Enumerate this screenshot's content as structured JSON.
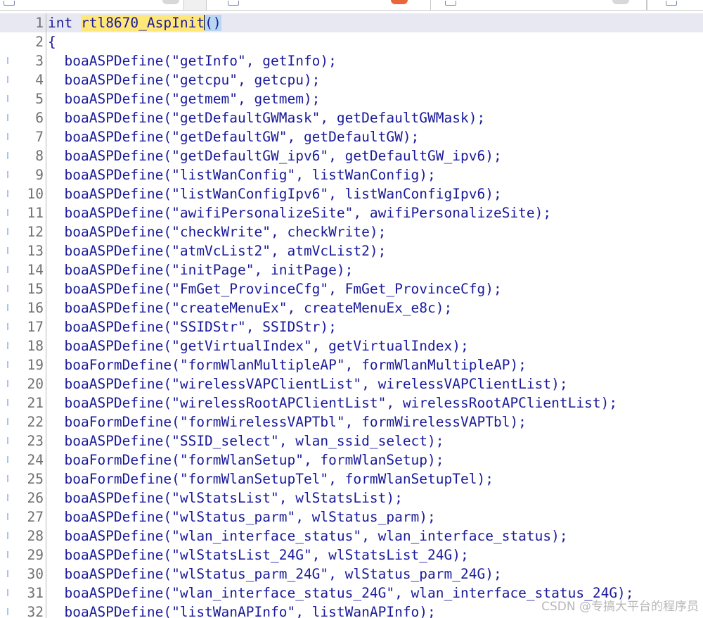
{
  "editor": {
    "lines": [
      {
        "n": "1",
        "text": "int rtl8670_AspInit()"
      },
      {
        "n": "2",
        "text": "{"
      },
      {
        "n": "3",
        "text": "  boaASPDefine(\"getInfo\", getInfo);"
      },
      {
        "n": "4",
        "text": "  boaASPDefine(\"getcpu\", getcpu);"
      },
      {
        "n": "5",
        "text": "  boaASPDefine(\"getmem\", getmem);"
      },
      {
        "n": "6",
        "text": "  boaASPDefine(\"getDefaultGWMask\", getDefaultGWMask);"
      },
      {
        "n": "7",
        "text": "  boaASPDefine(\"getDefaultGW\", getDefaultGW);"
      },
      {
        "n": "8",
        "text": "  boaASPDefine(\"getDefaultGW_ipv6\", getDefaultGW_ipv6);"
      },
      {
        "n": "9",
        "text": "  boaASPDefine(\"listWanConfig\", listWanConfig);"
      },
      {
        "n": "10",
        "text": "  boaASPDefine(\"listWanConfigIpv6\", listWanConfigIpv6);"
      },
      {
        "n": "11",
        "text": "  boaASPDefine(\"awifiPersonalizeSite\", awifiPersonalizeSite);"
      },
      {
        "n": "12",
        "text": "  boaASPDefine(\"checkWrite\", checkWrite);"
      },
      {
        "n": "13",
        "text": "  boaASPDefine(\"atmVcList2\", atmVcList2);"
      },
      {
        "n": "14",
        "text": "  boaASPDefine(\"initPage\", initPage);"
      },
      {
        "n": "15",
        "text": "  boaASPDefine(\"FmGet_ProvinceCfg\", FmGet_ProvinceCfg);"
      },
      {
        "n": "16",
        "text": "  boaASPDefine(\"createMenuEx\", createMenuEx_e8c);"
      },
      {
        "n": "17",
        "text": "  boaASPDefine(\"SSIDStr\", SSIDStr);"
      },
      {
        "n": "18",
        "text": "  boaASPDefine(\"getVirtualIndex\", getVirtualIndex);"
      },
      {
        "n": "19",
        "text": "  boaFormDefine(\"formWlanMultipleAP\", formWlanMultipleAP);"
      },
      {
        "n": "20",
        "text": "  boaASPDefine(\"wirelessVAPClientList\", wirelessVAPClientList);"
      },
      {
        "n": "21",
        "text": "  boaASPDefine(\"wirelessRootAPClientList\", wirelessRootAPClientList);"
      },
      {
        "n": "22",
        "text": "  boaFormDefine(\"formWirelessVAPTbl\", formWirelessVAPTbl);"
      },
      {
        "n": "23",
        "text": "  boaASPDefine(\"SSID_select\", wlan_ssid_select);"
      },
      {
        "n": "24",
        "text": "  boaFormDefine(\"formWlanSetup\", formWlanSetup);"
      },
      {
        "n": "25",
        "text": "  boaFormDefine(\"formWlanSetupTel\", formWlanSetupTel);"
      },
      {
        "n": "26",
        "text": "  boaASPDefine(\"wlStatsList\", wlStatsList);"
      },
      {
        "n": "27",
        "text": "  boaASPDefine(\"wlStatus_parm\", wlStatus_parm);"
      },
      {
        "n": "28",
        "text": "  boaASPDefine(\"wlan_interface_status\", wlan_interface_status);"
      },
      {
        "n": "29",
        "text": "  boaASPDefine(\"wlStatsList_24G\", wlStatsList_24G);"
      },
      {
        "n": "30",
        "text": "  boaASPDefine(\"wlStatus_parm_24G\", wlStatus_parm_24G);"
      },
      {
        "n": "31",
        "text": "  boaASPDefine(\"wlan_interface_status_24G\", wlan_interface_status_24G);"
      },
      {
        "n": "32",
        "text": "  boaASPDefine(\"listWanAPInfo\", listWanAPInfo);"
      }
    ],
    "first_line": {
      "keyword": "int ",
      "function_name": "rtl8670_AspInit",
      "parens": "()"
    }
  },
  "watermark": "CSDN @专搞大平台的程序员",
  "colors": {
    "code_text": "#1a1a9a",
    "line_number": "#6f6f6f",
    "highlight": "#ffe77a",
    "bracket_match": "#b9d7f2"
  }
}
